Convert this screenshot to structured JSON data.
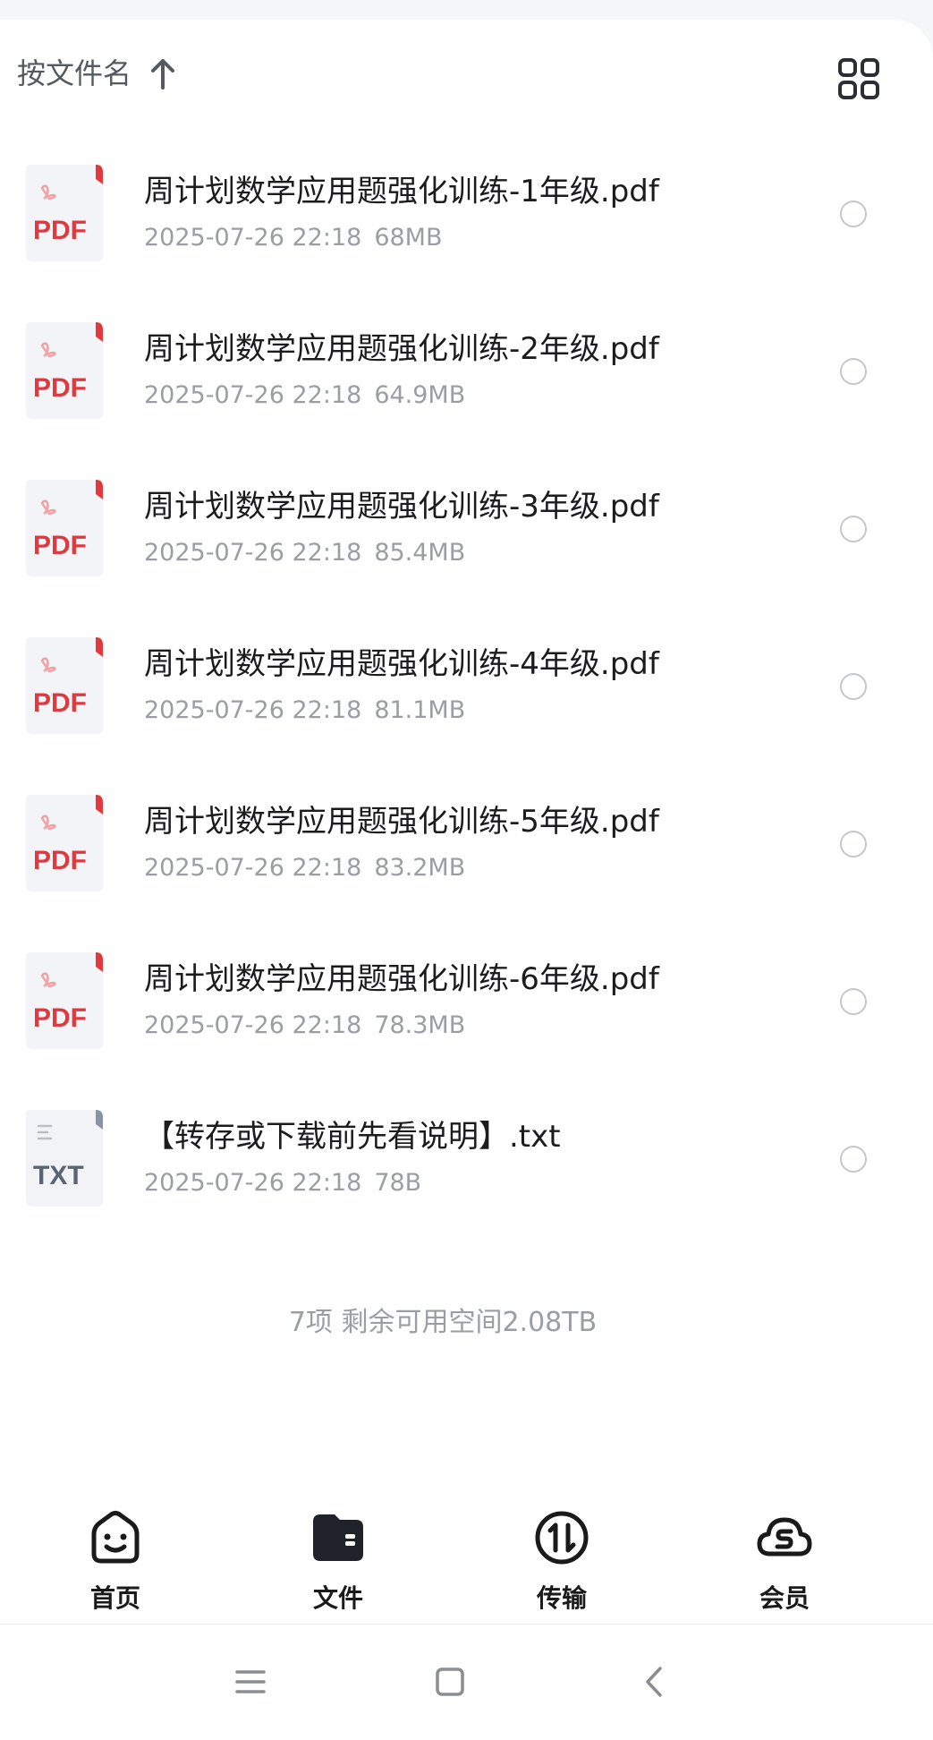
{
  "sort_bar": {
    "label": "按文件名",
    "arrow_icon": "arrow-up-icon",
    "view_toggle_icon": "grid-view-icon"
  },
  "files": [
    {
      "name": "周计划数学应用题强化训练-1年级.pdf",
      "date": "2025-07-26 22:18",
      "size": "68MB",
      "type_label": "PDF",
      "icon": "pdf-file-icon"
    },
    {
      "name": "周计划数学应用题强化训练-2年级.pdf",
      "date": "2025-07-26 22:18",
      "size": "64.9MB",
      "type_label": "PDF",
      "icon": "pdf-file-icon"
    },
    {
      "name": "周计划数学应用题强化训练-3年级.pdf",
      "date": "2025-07-26 22:18",
      "size": "85.4MB",
      "type_label": "PDF",
      "icon": "pdf-file-icon"
    },
    {
      "name": "周计划数学应用题强化训练-4年级.pdf",
      "date": "2025-07-26 22:18",
      "size": "81.1MB",
      "type_label": "PDF",
      "icon": "pdf-file-icon"
    },
    {
      "name": "周计划数学应用题强化训练-5年级.pdf",
      "date": "2025-07-26 22:18",
      "size": "83.2MB",
      "type_label": "PDF",
      "icon": "pdf-file-icon"
    },
    {
      "name": "周计划数学应用题强化训练-6年级.pdf",
      "date": "2025-07-26 22:18",
      "size": "78.3MB",
      "type_label": "PDF",
      "icon": "pdf-file-icon"
    },
    {
      "name": "【转存或下载前先看说明】.txt",
      "date": "2025-07-26 22:18",
      "size": "78B",
      "type_label": "TXT",
      "icon": "txt-file-icon"
    }
  ],
  "summary": "7项 剩余可用空间2.08TB",
  "bottom_nav": [
    {
      "label": "首页",
      "icon": "smiley-home-icon"
    },
    {
      "label": "文件",
      "icon": "folder-icon",
      "active": true
    },
    {
      "label": "传输",
      "icon": "transfer-icon"
    },
    {
      "label": "会员",
      "icon": "vip-cloud-icon"
    }
  ],
  "system_nav": {
    "menu_icon": "menu-icon",
    "home_icon": "square-home-icon",
    "back_icon": "back-icon"
  },
  "colors": {
    "pdf_red": "#e0393e",
    "txt_gray": "#5b6472",
    "text_primary": "#1c1c1e",
    "text_secondary": "#9a9ea4"
  }
}
